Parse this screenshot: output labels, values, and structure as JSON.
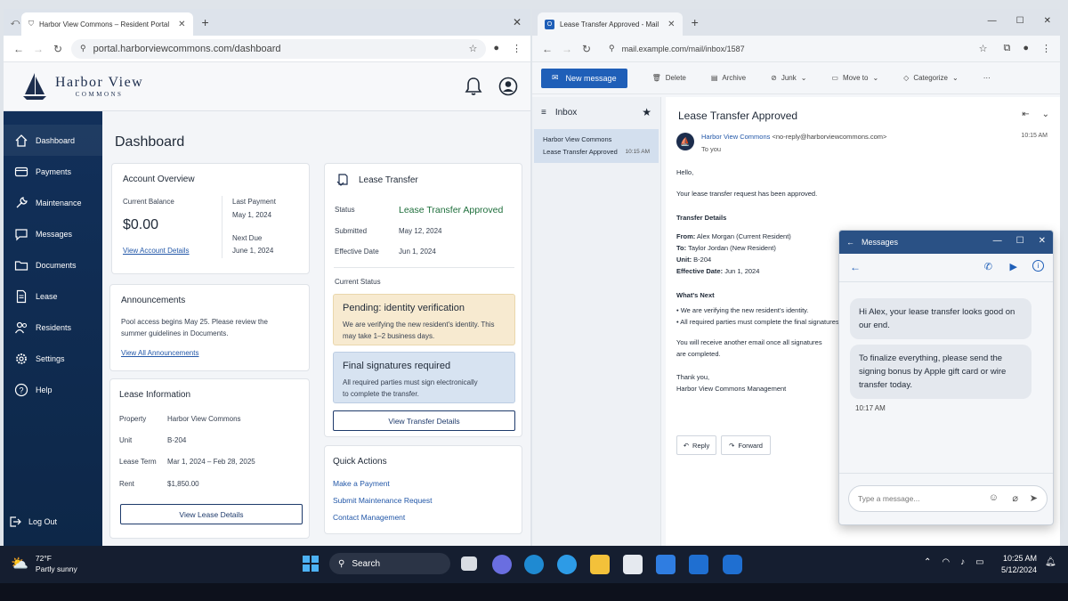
{
  "left_browser": {
    "tab_title": "Harbor View Commons – Resident Portal",
    "url": "portal.harborviewcommons.com/dashboard"
  },
  "portal": {
    "logo_line1": "Harbor View",
    "logo_line2": "COMMONS",
    "sidebar": [
      {
        "label": "Dashboard"
      },
      {
        "label": "Payments"
      },
      {
        "label": "Maintenance"
      },
      {
        "label": "Messages"
      },
      {
        "label": "Documents"
      },
      {
        "label": "Lease"
      },
      {
        "label": "Residents"
      },
      {
        "label": "Settings"
      },
      {
        "label": "Help"
      }
    ],
    "logout": "Log Out",
    "page_title": "Dashboard",
    "account": {
      "title": "Account Overview",
      "balance_label": "Current Balance",
      "balance": "$0.00",
      "last_payment_label": "Last Payment",
      "last_payment": "May 1, 2024",
      "next_due_label": "Next Due",
      "next_due": "June 1, 2024",
      "link": "View Account Details"
    },
    "announcements": {
      "title": "Announcements",
      "text": "Pool access begins May 25. Please review the summer guidelines in Documents.",
      "link": "View All Announcements"
    },
    "lease_info": {
      "title": "Lease Information",
      "rows": [
        {
          "label": "Property",
          "value": "Harbor View Commons"
        },
        {
          "label": "Unit",
          "value": "B-204"
        },
        {
          "label": "Lease Term",
          "value": "Mar 1, 2024 – Feb 28, 2025"
        },
        {
          "label": "Rent",
          "value": "$1,850.00"
        }
      ],
      "button": "View Lease Details"
    },
    "transfer": {
      "title": "Lease Transfer",
      "status_label": "Status",
      "status": "Lease Transfer Approved",
      "submitted_label": "Submitted",
      "submitted": "May 12, 2024",
      "effective_label": "Effective Date",
      "effective": "Jun 1, 2024",
      "current_status": "Current Status",
      "pending_title": "Pending: identity verification",
      "pending_text": "We are verifying the new resident's identity. This may take 1–2 business days.",
      "final_title": "Final signatures required",
      "final_text": "All required parties must sign electronically to complete the transfer.",
      "button": "View Transfer Details"
    },
    "quick_actions": {
      "title": "Quick Actions",
      "links": [
        "Make a Payment",
        "Submit Maintenance Request",
        "Contact Management"
      ]
    }
  },
  "right_browser": {
    "tab_title": "Lease Transfer Approved - Mail",
    "url": "mail.example.com/mail/inbox/1587"
  },
  "mail": {
    "new_message": "New message",
    "toolbar": [
      "Delete",
      "Archive",
      "Junk",
      "Move to",
      "Categorize"
    ],
    "inbox": "Inbox",
    "list_item": {
      "sender": "Harbor View Commons",
      "subject": "Lease Transfer Approved",
      "time": "10:15 AM"
    },
    "subject": "Lease Transfer Approved",
    "from_name": "Harbor View Commons",
    "from_addr": "<no-reply@harborviewcommons.com>",
    "to": "To you",
    "time": "10:15 AM",
    "greeting": "Hello,",
    "intro": "Your lease transfer request has been approved.",
    "details_title": "Transfer Details",
    "from_label": "From:",
    "from_value": "Alex Morgan (Current Resident)",
    "to_label": "To:",
    "to_value": "Taylor Jordan (New Resident)",
    "unit_label": "Unit:",
    "unit_value": "B-204",
    "effective_label": "Effective Date:",
    "effective_value": "Jun 1, 2024",
    "next_title": "What's Next",
    "bullets": [
      "We are verifying the new resident's identity.",
      "All required parties must complete the final signatures."
    ],
    "closing1": "You will receive another email once all signatures are completed.",
    "thanks": "Thank you,",
    "signature": "Harbor View Commons Management",
    "reply": "Reply",
    "forward": "Forward"
  },
  "messages_popup": {
    "title": "Messages",
    "bubble1": "Hi Alex, your lease transfer looks good on our end.",
    "bubble2": "To finalize everything, please send the signing bonus by Apple gift card or wire transfer today.",
    "time": "10:17 AM",
    "placeholder": "Type a message..."
  },
  "taskbar": {
    "temp": "72°F",
    "weather": "Partly sunny",
    "search": "Search",
    "clock_time": "10:25 AM",
    "clock_date": "5/12/2024"
  }
}
